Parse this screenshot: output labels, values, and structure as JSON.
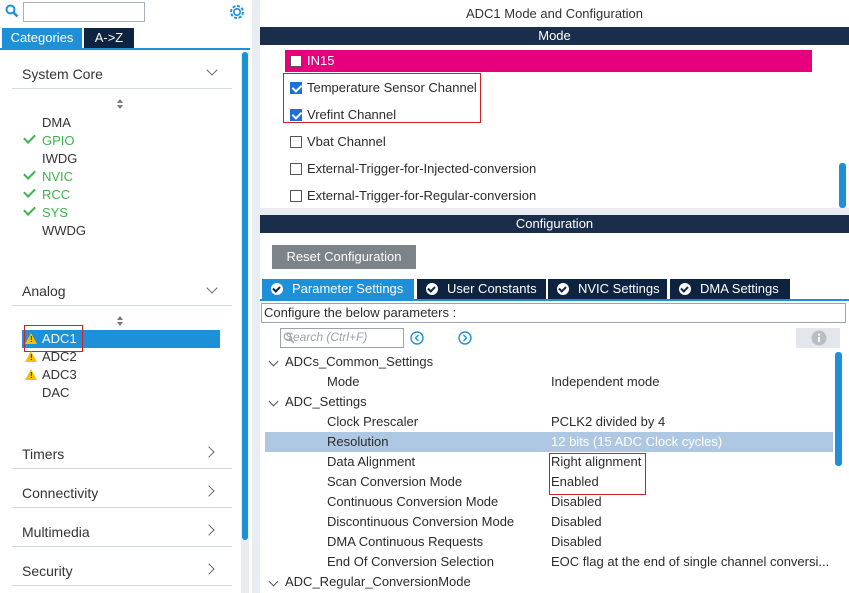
{
  "left": {
    "search": {
      "value": ""
    },
    "tabs": [
      {
        "label": "Categories"
      },
      {
        "label": "A->Z"
      }
    ],
    "system_core": {
      "title": "System Core",
      "items": [
        {
          "label": "DMA",
          "status": "none"
        },
        {
          "label": "GPIO",
          "status": "ok"
        },
        {
          "label": "IWDG",
          "status": "none"
        },
        {
          "label": "NVIC",
          "status": "ok"
        },
        {
          "label": "RCC",
          "status": "ok"
        },
        {
          "label": "SYS",
          "status": "ok"
        },
        {
          "label": "WWDG",
          "status": "none"
        }
      ]
    },
    "analog": {
      "title": "Analog",
      "items": [
        {
          "label": "ADC1",
          "status": "warning",
          "selected": true
        },
        {
          "label": "ADC2",
          "status": "warning"
        },
        {
          "label": "ADC3",
          "status": "warning"
        },
        {
          "label": "DAC",
          "status": "none"
        }
      ]
    },
    "categories": [
      {
        "label": "Timers"
      },
      {
        "label": "Connectivity"
      },
      {
        "label": "Multimedia"
      },
      {
        "label": "Security"
      }
    ]
  },
  "right": {
    "title": "ADC1 Mode and Configuration",
    "mode_bar": "Mode",
    "mode_items": [
      {
        "label": "IN15",
        "checked": false,
        "highlight": true
      },
      {
        "label": "Temperature Sensor Channel",
        "checked": true
      },
      {
        "label": "Vrefint Channel",
        "checked": true
      },
      {
        "label": "Vbat Channel",
        "checked": false
      },
      {
        "label": "External-Trigger-for-Injected-conversion",
        "checked": false
      },
      {
        "label": "External-Trigger-for-Regular-conversion",
        "checked": false
      }
    ],
    "config_bar": "Configuration",
    "reset_button": "Reset Configuration",
    "param_tabs": [
      {
        "label": "Parameter Settings",
        "active": true
      },
      {
        "label": "User Constants"
      },
      {
        "label": "NVIC Settings"
      },
      {
        "label": "DMA Settings"
      }
    ],
    "configure_label": "Configure the below parameters :",
    "search_placeholder": "Search (Ctrl+F)",
    "tree": {
      "group1": "ADCs_Common_Settings",
      "mode_key": "Mode",
      "mode_val": "Independent mode",
      "group2": "ADC_Settings",
      "rows": [
        {
          "key": "Clock Prescaler",
          "value": "PCLK2 divided by 4"
        },
        {
          "key": "Resolution",
          "value": "12 bits (15 ADC Clock cycles)"
        },
        {
          "key": "Data Alignment",
          "value": "Right alignment"
        },
        {
          "key": "Scan Conversion Mode",
          "value": "Enabled"
        },
        {
          "key": "Continuous Conversion Mode",
          "value": "Disabled"
        },
        {
          "key": "Discontinuous Conversion Mode",
          "value": "Disabled"
        },
        {
          "key": "DMA Continuous Requests",
          "value": "Disabled"
        },
        {
          "key": "End Of Conversion Selection",
          "value": "EOC flag at the end of single channel conversi..."
        }
      ],
      "group3": "ADC_Regular_ConversionMode"
    },
    "colors": {
      "header": "#1a2d4a",
      "tab": "#0d2340",
      "accent": "#1e90d8",
      "highlight": "#e6007e",
      "selected_row": "#aec8e4",
      "warning": "#f2c200",
      "ok": "#3bb54a",
      "outline": "#d0202a"
    }
  }
}
